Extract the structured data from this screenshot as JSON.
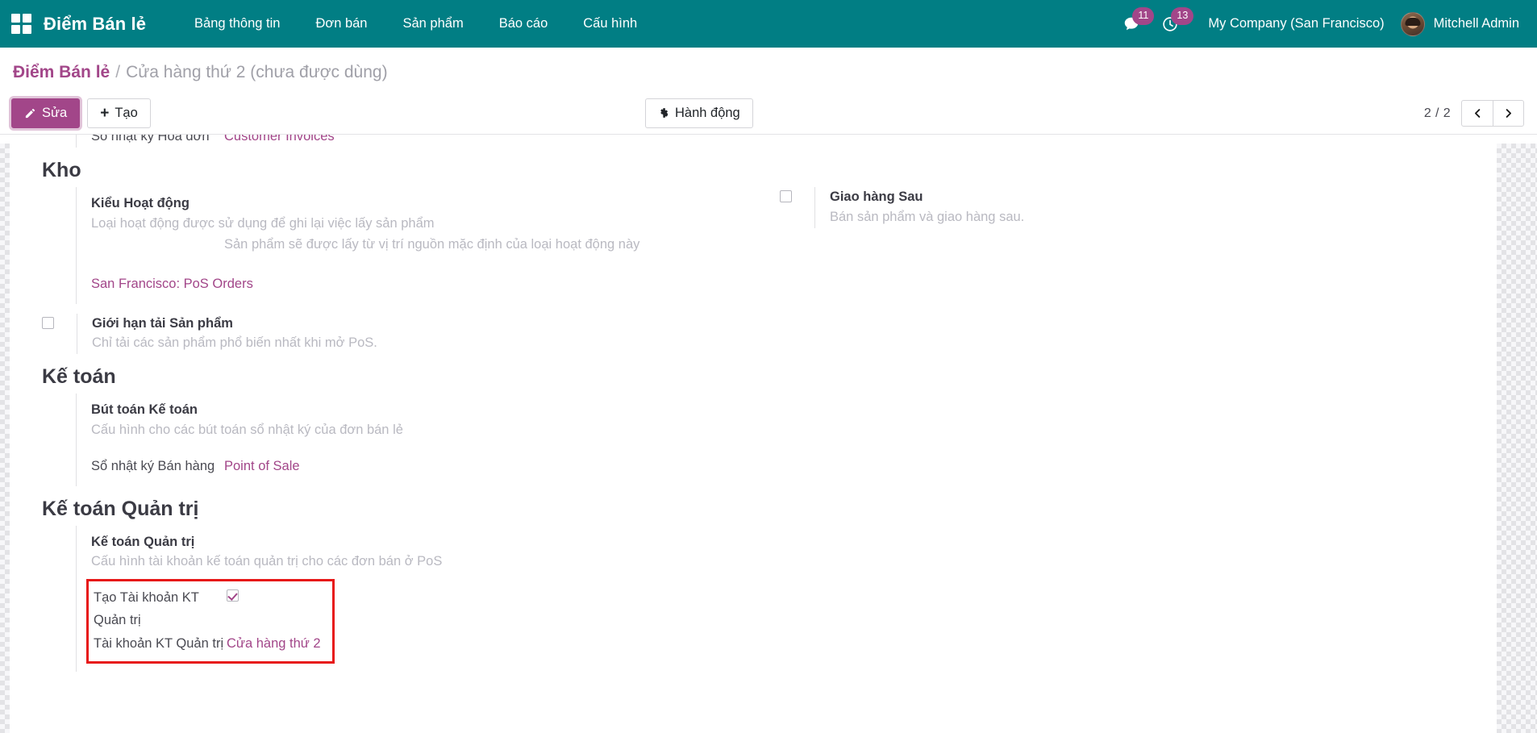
{
  "navbar": {
    "apps_icon": "apps-grid-icon",
    "brand": "Điểm Bán lẻ",
    "menu": [
      {
        "label": "Bảng thông tin"
      },
      {
        "label": "Đơn bán"
      },
      {
        "label": "Sản phẩm"
      },
      {
        "label": "Báo cáo"
      },
      {
        "label": "Cấu hình"
      }
    ],
    "messages_icon": "chat-bubble-icon",
    "messages_count": "11",
    "activities_icon": "clock-icon",
    "activities_count": "13",
    "company": "My Company (San Francisco)",
    "user": "Mitchell Admin",
    "colors": {
      "navbar_bg": "#017e84",
      "badge_bg": "#a24689"
    }
  },
  "breadcrumb": {
    "root": "Điểm Bán lẻ",
    "separator": "/",
    "current": "Cửa hàng thứ 2 (chưa được dùng)"
  },
  "control": {
    "edit_label": "Sửa",
    "create_label": "Tạo",
    "action_label": "Hành động",
    "pager_count": "2 / 2",
    "prev_icon": "chevron-left-icon",
    "next_icon": "chevron-right-icon",
    "accent": "#a24689"
  },
  "form": {
    "top_field": {
      "label": "Sổ nhật ký Hoá đơn",
      "value": "Customer Invoices"
    },
    "sections": [
      {
        "title": "Kho",
        "operation_type": {
          "title": "Kiểu Hoạt động",
          "desc": "Loại hoạt động được sử dụng để ghi lại việc lấy sản phẩm",
          "desc2": "Sản phẩm sẽ được lấy từ vị trí nguồn mặc định của loại hoạt động này",
          "value": "San Francisco: PoS Orders"
        },
        "ship_later": {
          "title": "Giao hàng Sau",
          "desc": "Bán sản phẩm và giao hàng sau.",
          "checked": false
        },
        "limit_products": {
          "title": "Giới hạn tải Sản phẩm",
          "desc": "Chỉ tải các sản phẩm phổ biến nhất khi mở PoS.",
          "checked": false
        }
      },
      {
        "title": "Kế toán",
        "journal_entries": {
          "title": "Bút toán Kế toán",
          "desc": "Cấu hình cho các bút toán sổ nhật ký của đơn bán lẻ",
          "field_label": "Sổ nhật ký Bán hàng",
          "field_value": "Point of Sale"
        }
      },
      {
        "title": "Kế toán Quản trị",
        "analytic": {
          "title": "Kế toán Quản trị",
          "desc": "Cấu hình tài khoản kế toán quản trị cho các đơn bán ở PoS",
          "create_label_line1": "Tạo Tài khoản KT",
          "create_label_line2": "Quản trị",
          "create_checked": true,
          "account_label": "Tài khoản KT Quản trị",
          "account_value": "Cửa hàng thứ 2",
          "highlight_color": "#e71717"
        }
      }
    ]
  }
}
